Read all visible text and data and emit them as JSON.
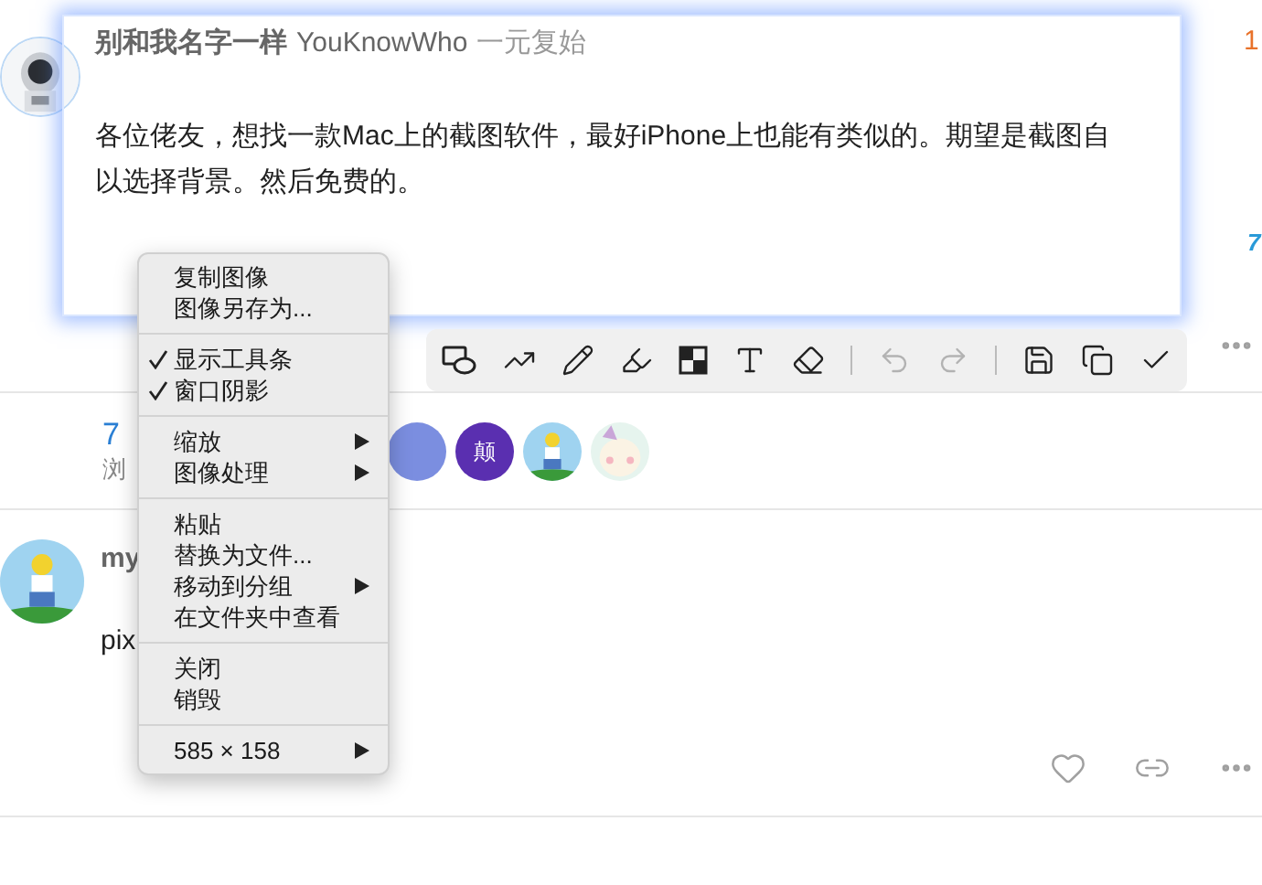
{
  "posts": [
    {
      "author": "别和我名字一样",
      "username": "YouKnowWho",
      "user_title": "一元复始",
      "body": [
        "各位佬友，想找一款Mac上的截图软件，最好iPhone上也能有类似的。期望是截图自",
        "以选择背景。然后免费的。"
      ],
      "post_number": "1",
      "side_count": "7",
      "stats": [
        {
          "value": "7",
          "label": "浏"
        }
      ],
      "participants": [
        {
          "kind": "letter",
          "color": "#7b8ee0"
        },
        {
          "kind": "letter",
          "text": "颠",
          "color": "#5a2fb0"
        },
        {
          "kind": "picture"
        },
        {
          "kind": "picture"
        }
      ]
    },
    {
      "author": "my",
      "body": [
        "pix"
      ]
    }
  ],
  "toolbar": [
    {
      "kind": "shape",
      "disabled": false
    },
    {
      "kind": "arrow",
      "disabled": false
    },
    {
      "kind": "pencil",
      "disabled": false
    },
    {
      "kind": "highlighter",
      "disabled": false
    },
    {
      "kind": "mosaic",
      "disabled": false
    },
    {
      "kind": "text",
      "disabled": false
    },
    {
      "kind": "eraser",
      "disabled": false
    },
    {
      "kind": "divider"
    },
    {
      "kind": "undo",
      "disabled": true
    },
    {
      "kind": "redo",
      "disabled": true
    },
    {
      "kind": "divider"
    },
    {
      "kind": "save",
      "disabled": false
    },
    {
      "kind": "copy",
      "disabled": false
    },
    {
      "kind": "confirm",
      "disabled": false
    }
  ],
  "context_menu": [
    {
      "items": [
        {
          "label": "复制图像",
          "checked": false,
          "submenu": false
        },
        {
          "label": "图像另存为...",
          "checked": false,
          "submenu": false
        }
      ]
    },
    {
      "items": [
        {
          "label": "显示工具条",
          "checked": true,
          "submenu": false
        },
        {
          "label": "窗口阴影",
          "checked": true,
          "submenu": false
        }
      ]
    },
    {
      "items": [
        {
          "label": "缩放",
          "checked": false,
          "submenu": true
        },
        {
          "label": "图像处理",
          "checked": false,
          "submenu": true
        }
      ]
    },
    {
      "items": [
        {
          "label": "粘贴",
          "checked": false,
          "submenu": false
        },
        {
          "label": "替换为文件...",
          "checked": false,
          "submenu": false
        },
        {
          "label": "移动到分组",
          "checked": false,
          "submenu": true
        },
        {
          "label": "在文件夹中查看",
          "checked": false,
          "submenu": false
        }
      ]
    },
    {
      "items": [
        {
          "label": "关闭",
          "checked": false,
          "submenu": false
        },
        {
          "label": "销毁",
          "checked": false,
          "submenu": false
        }
      ]
    },
    {
      "items": [
        {
          "label": "585 × 158",
          "checked": false,
          "submenu": true
        }
      ]
    }
  ]
}
